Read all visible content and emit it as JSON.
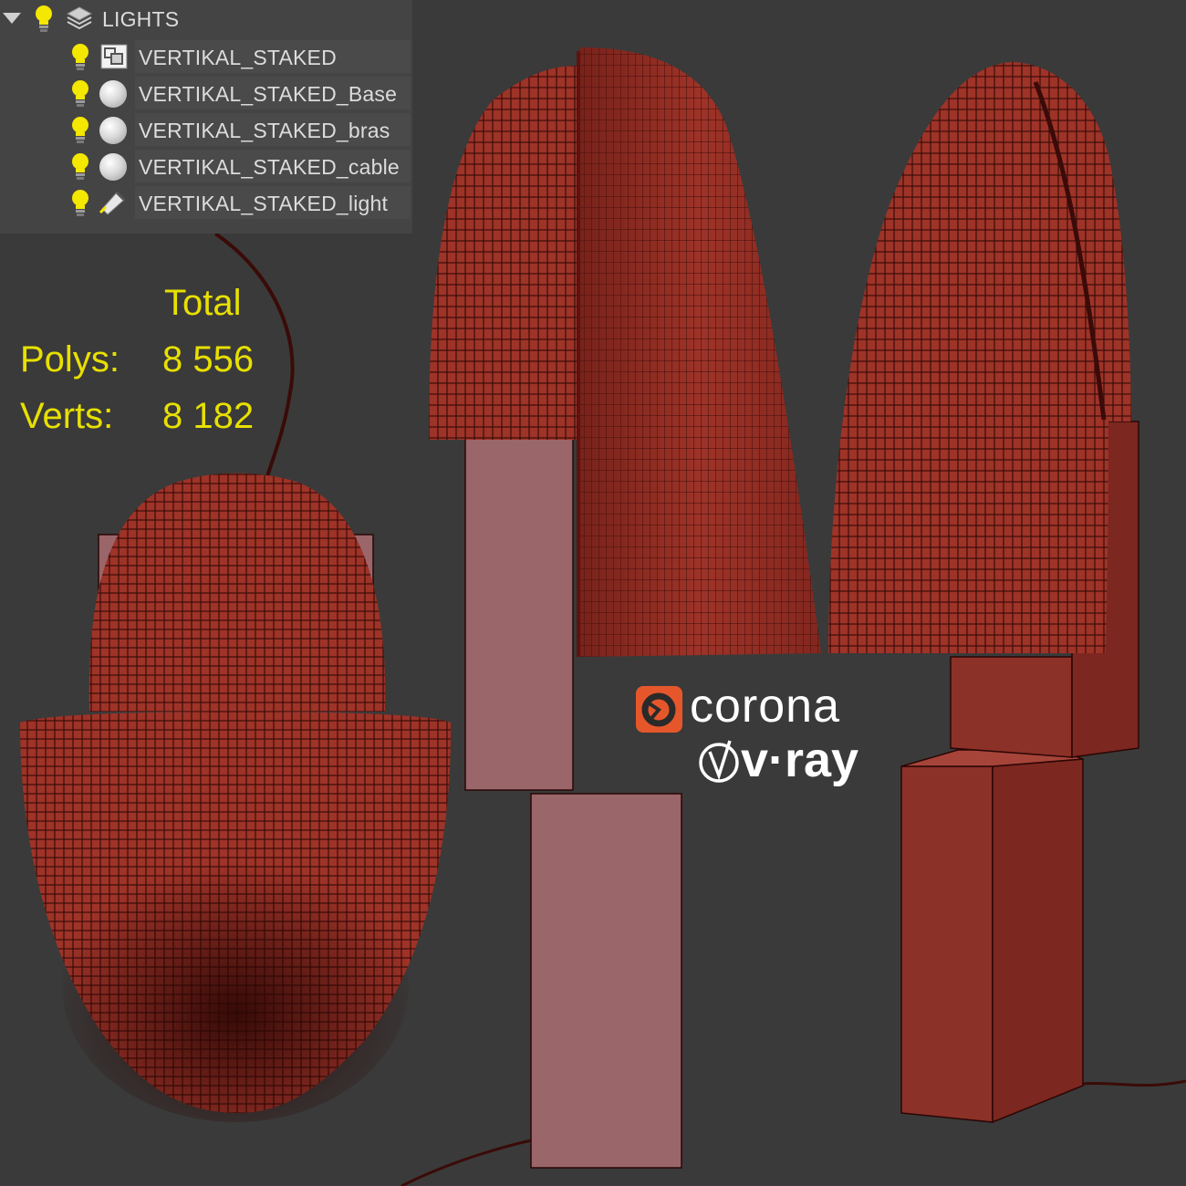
{
  "explorer": {
    "layer": {
      "label": "LIGHTS",
      "icon": "layers-icon"
    },
    "items": [
      {
        "label": "VERTIKAL_STAKED",
        "icon": "group-icon"
      },
      {
        "label": "VERTIKAL_STAKED_Base",
        "icon": "sphere-icon"
      },
      {
        "label": "VERTIKAL_STAKED_bras",
        "icon": "sphere-icon"
      },
      {
        "label": "VERTIKAL_STAKED_cable",
        "icon": "sphere-icon"
      },
      {
        "label": "VERTIKAL_STAKED_light",
        "icon": "spotlight-icon"
      }
    ]
  },
  "stats": {
    "header": "Total",
    "polys_label": "Polys:",
    "polys_value": "8 556",
    "verts_label": "Verts:",
    "verts_value": "8 182"
  },
  "logos": {
    "corona": "corona",
    "vray": "v·ray"
  },
  "colors": {
    "background": "#3a3a3a",
    "mesh": "#9e3328",
    "wire": "#3a0b08",
    "base_front": "#9a666a",
    "base_side": "#8c3128",
    "hud_text": "#e8e000",
    "corona_orange": "#e5572b"
  }
}
